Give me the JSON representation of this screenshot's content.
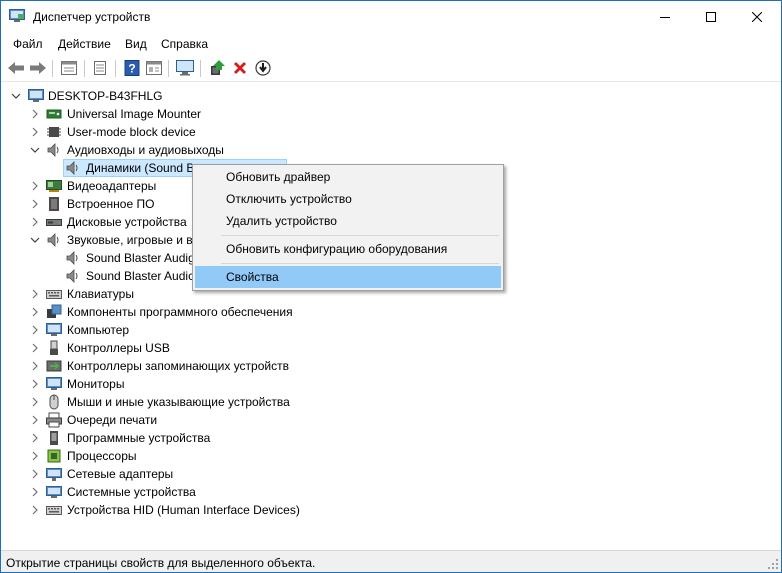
{
  "window": {
    "title": "Диспетчер устройств",
    "accent_color": "#1f6fb8"
  },
  "menu": [
    "Файл",
    "Действие",
    "Вид",
    "Справка"
  ],
  "toolbar": {
    "icons": [
      "back-arrow-icon",
      "forward-arrow-icon",
      "properties-icon",
      "update-list-icon",
      "help-icon",
      "view-icon",
      "monitor-scan-icon",
      "update-driver-icon",
      "uninstall-x-icon",
      "download-arrow-icon"
    ]
  },
  "tree": {
    "root": "DESKTOP-B43FHLG",
    "items": [
      {
        "label": "Universal Image Mounter",
        "icon": "disk-mount-icon",
        "expanded": false
      },
      {
        "label": "User-mode block device",
        "icon": "chip-icon",
        "expanded": false
      },
      {
        "label": "Аудиовходы и аудиовыходы",
        "icon": "speaker-icon",
        "expanded": true
      },
      {
        "label": "Динамики (Sound B",
        "icon": "speaker-icon",
        "child": true,
        "selected": true
      },
      {
        "label": "Видеоадаптеры",
        "icon": "display-adapter-icon",
        "expanded": false
      },
      {
        "label": "Встроенное ПО",
        "icon": "firmware-icon",
        "expanded": false
      },
      {
        "label": "Дисковые устройства",
        "icon": "disk-drive-icon",
        "expanded": false
      },
      {
        "label": "Звуковые, игровые и в",
        "icon": "speaker-icon",
        "expanded": true
      },
      {
        "label": "Sound Blaster Audig",
        "icon": "speaker-icon",
        "child": true
      },
      {
        "label": "Sound Blaster Audic",
        "icon": "speaker-icon",
        "child": true
      },
      {
        "label": "Клавиатуры",
        "icon": "keyboard-icon",
        "expanded": false
      },
      {
        "label": "Компоненты программного обеспечения",
        "icon": "software-component-icon",
        "expanded": false
      },
      {
        "label": "Компьютер",
        "icon": "computer-icon",
        "expanded": false
      },
      {
        "label": "Контроллеры USB",
        "icon": "usb-icon",
        "expanded": false
      },
      {
        "label": "Контроллеры запоминающих устройств",
        "icon": "storage-controller-icon",
        "expanded": false
      },
      {
        "label": "Мониторы",
        "icon": "monitor-icon",
        "expanded": false
      },
      {
        "label": "Мыши и иные указывающие устройства",
        "icon": "mouse-icon",
        "expanded": false
      },
      {
        "label": "Очереди печати",
        "icon": "printer-icon",
        "expanded": false
      },
      {
        "label": "Программные устройства",
        "icon": "software-device-icon",
        "expanded": false
      },
      {
        "label": "Процессоры",
        "icon": "processor-icon",
        "expanded": false
      },
      {
        "label": "Сетевые адаптеры",
        "icon": "network-adapter-icon",
        "expanded": false
      },
      {
        "label": "Системные устройства",
        "icon": "system-device-icon",
        "expanded": false
      },
      {
        "label": "Устройства HID (Human Interface Devices)",
        "icon": "hid-icon",
        "expanded": false
      }
    ]
  },
  "context_menu": {
    "items": [
      "Обновить драйвер",
      "Отключить устройство",
      "Удалить устройство",
      "Обновить конфигурацию оборудования",
      "Свойства"
    ],
    "highlighted": "Свойства",
    "highlight_color": "#91c9f7"
  },
  "status": {
    "text": "Открытие страницы свойств для выделенного объекта."
  }
}
